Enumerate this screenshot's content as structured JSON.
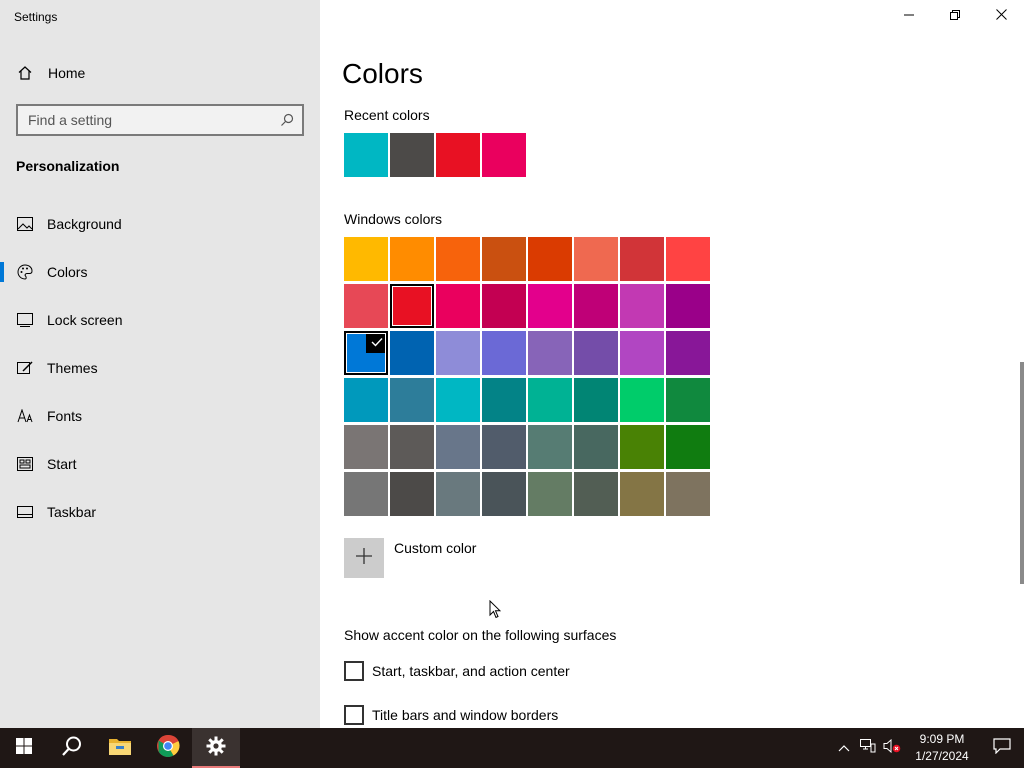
{
  "window": {
    "title": "Settings"
  },
  "sidebar": {
    "home_label": "Home",
    "search_placeholder": "Find a setting",
    "section_title": "Personalization",
    "items": [
      {
        "label": "Background",
        "icon": "picture-icon"
      },
      {
        "label": "Colors",
        "icon": "palette-icon",
        "active": true
      },
      {
        "label": "Lock screen",
        "icon": "lock-screen-icon"
      },
      {
        "label": "Themes",
        "icon": "themes-brush-icon"
      },
      {
        "label": "Fonts",
        "icon": "font-icon"
      },
      {
        "label": "Start",
        "icon": "start-tiles-icon"
      },
      {
        "label": "Taskbar",
        "icon": "taskbar-icon"
      }
    ]
  },
  "main": {
    "title": "Colors",
    "recent_label": "Recent colors",
    "recent_colors": [
      "#00b7c3",
      "#4c4a48",
      "#e81123",
      "#ea005e"
    ],
    "windows_label": "Windows colors",
    "windows_colors": [
      "#ffb900",
      "#ff8c00",
      "#f7630c",
      "#ca5010",
      "#da3b01",
      "#ef6950",
      "#d13438",
      "#ff4343",
      "#e74856",
      "#e81123",
      "#ea005e",
      "#c30052",
      "#e3008c",
      "#bf0077",
      "#c239b3",
      "#9a0089",
      "#0078d7",
      "#0063b1",
      "#8e8cd8",
      "#6b69d6",
      "#8764b8",
      "#744da9",
      "#b146c2",
      "#881798",
      "#0099bc",
      "#2d7d9a",
      "#00b7c3",
      "#038387",
      "#00b294",
      "#018574",
      "#00cc6a",
      "#10893e",
      "#7a7574",
      "#5d5a58",
      "#68768a",
      "#515c6b",
      "#567c73",
      "#486860",
      "#498205",
      "#107c10",
      "#767676",
      "#4c4a48",
      "#69797e",
      "#4a5459",
      "#647c64",
      "#525e54",
      "#847545",
      "#7e735f"
    ],
    "selected_index": 16,
    "recent_selected_index": 9,
    "custom_color_label": "Custom color",
    "accent_label": "Show accent color on the following surfaces",
    "checkboxes": [
      {
        "label": "Start, taskbar, and action center",
        "checked": false
      },
      {
        "label": "Title bars and window borders",
        "checked": false
      }
    ]
  },
  "taskbar": {
    "time": "9:09 PM",
    "date": "1/27/2024",
    "apps": [
      "start-icon",
      "search-icon",
      "file-explorer-icon",
      "chrome-icon",
      "settings-gear-icon"
    ]
  }
}
